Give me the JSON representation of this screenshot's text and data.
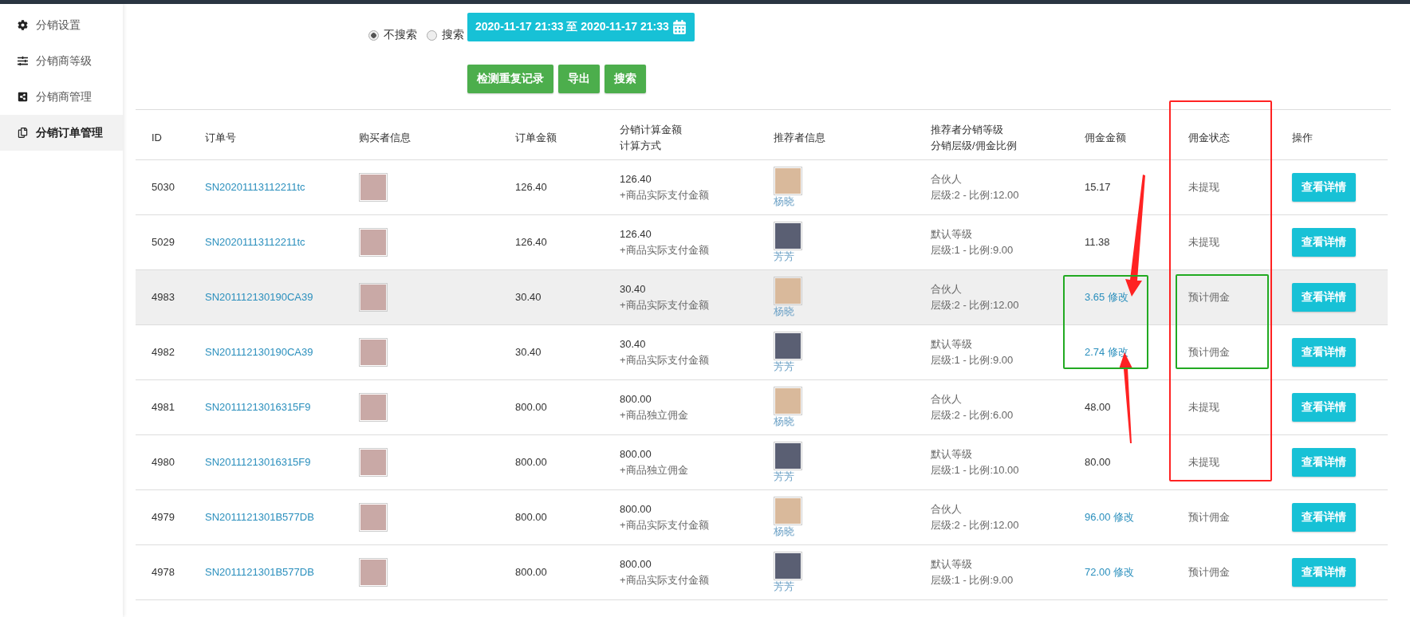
{
  "sidebar": {
    "items": [
      {
        "label": "分销设置",
        "selected": false
      },
      {
        "label": "分销商等级",
        "selected": false
      },
      {
        "label": "分销商管理",
        "selected": false
      },
      {
        "label": "分销订单管理",
        "selected": true
      }
    ]
  },
  "filter": {
    "options": [
      {
        "label": "不搜索",
        "selected": true
      },
      {
        "label": "搜索",
        "selected": false
      }
    ],
    "date_range": "2020-11-17 21:33 至 2020-11-17 21:33",
    "buttons": [
      "检测重复记录",
      "导出",
      "搜索"
    ]
  },
  "table": {
    "columns": [
      [
        "ID"
      ],
      [
        "订单号"
      ],
      [
        "购买者信息"
      ],
      [
        "订单金额"
      ],
      [
        "分销计算金额",
        "计算方式"
      ],
      [
        "推荐者信息"
      ],
      [
        "推荐者分销等级",
        "分销层级/佣金比例"
      ],
      [
        "佣金金额"
      ],
      [
        "佣金状态"
      ],
      [
        "操作"
      ]
    ],
    "rows": [
      {
        "id": "5030",
        "order_no": "SN20201113112211tc",
        "order_amount": "126.40",
        "calc_amount": "126.40",
        "calc_method": "+商品实际支付金额",
        "referrer": "杨晓",
        "level_name": "合伙人",
        "level_detail": "层级:2 - 比例:12.00",
        "commission": "15.17",
        "editable": false,
        "status": "未提现",
        "action": "查看详情",
        "highlighted": false
      },
      {
        "id": "5029",
        "order_no": "SN20201113112211tc",
        "order_amount": "126.40",
        "calc_amount": "126.40",
        "calc_method": "+商品实际支付金额",
        "referrer": "芳芳",
        "level_name": "默认等级",
        "level_detail": "层级:1 - 比例:9.00",
        "commission": "11.38",
        "editable": false,
        "status": "未提现",
        "action": "查看详情",
        "highlighted": false
      },
      {
        "id": "4983",
        "order_no": "SN201112130190CA39",
        "order_amount": "30.40",
        "calc_amount": "30.40",
        "calc_method": "+商品实际支付金额",
        "referrer": "杨晓",
        "level_name": "合伙人",
        "level_detail": "层级:2 - 比例:12.00",
        "commission": "3.65",
        "editable": true,
        "edit_label": "修改",
        "status": "预计佣金",
        "action": "查看详情",
        "highlighted": true
      },
      {
        "id": "4982",
        "order_no": "SN201112130190CA39",
        "order_amount": "30.40",
        "calc_amount": "30.40",
        "calc_method": "+商品实际支付金额",
        "referrer": "芳芳",
        "level_name": "默认等级",
        "level_detail": "层级:1 - 比例:9.00",
        "commission": "2.74",
        "editable": true,
        "edit_label": "修改",
        "status": "预计佣金",
        "action": "查看详情",
        "highlighted": false
      },
      {
        "id": "4981",
        "order_no": "SN20111213016315F9",
        "order_amount": "800.00",
        "calc_amount": "800.00",
        "calc_method": "+商品独立佣金",
        "referrer": "杨晓",
        "level_name": "合伙人",
        "level_detail": "层级:2 - 比例:6.00",
        "commission": "48.00",
        "editable": false,
        "status": "未提现",
        "action": "查看详情",
        "highlighted": false
      },
      {
        "id": "4980",
        "order_no": "SN20111213016315F9",
        "order_amount": "800.00",
        "calc_amount": "800.00",
        "calc_method": "+商品独立佣金",
        "referrer": "芳芳",
        "level_name": "默认等级",
        "level_detail": "层级:1 - 比例:10.00",
        "commission": "80.00",
        "editable": false,
        "status": "未提现",
        "action": "查看详情",
        "highlighted": false
      },
      {
        "id": "4979",
        "order_no": "SN2011121301B577DB",
        "order_amount": "800.00",
        "calc_amount": "800.00",
        "calc_method": "+商品实际支付金额",
        "referrer": "杨晓",
        "level_name": "合伙人",
        "level_detail": "层级:2 - 比例:12.00",
        "commission": "96.00",
        "editable": true,
        "edit_label": "修改",
        "status": "预计佣金",
        "action": "查看详情",
        "highlighted": false
      },
      {
        "id": "4978",
        "order_no": "SN2011121301B577DB",
        "order_amount": "800.00",
        "calc_amount": "800.00",
        "calc_method": "+商品实际支付金额",
        "referrer": "芳芳",
        "level_name": "默认等级",
        "level_detail": "层级:1 - 比例:9.00",
        "commission": "72.00",
        "editable": true,
        "edit_label": "修改",
        "status": "预计佣金",
        "action": "查看详情",
        "highlighted": false
      }
    ]
  }
}
